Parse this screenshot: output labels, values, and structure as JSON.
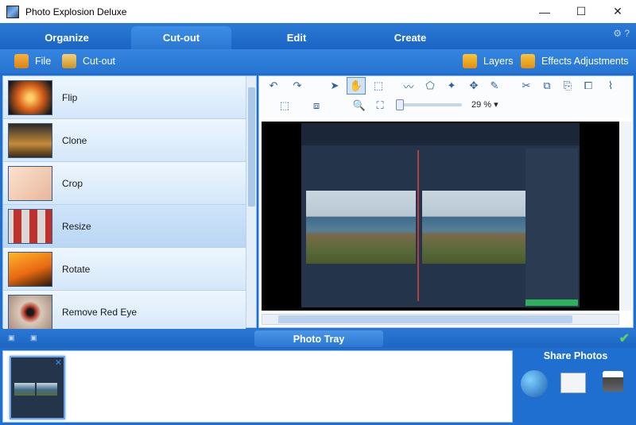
{
  "window": {
    "title": "Photo Explosion Deluxe",
    "minimize": "—",
    "maximize": "☐",
    "close": "✕"
  },
  "tabs": [
    {
      "label": "Organize"
    },
    {
      "label": "Cut-out"
    },
    {
      "label": "Edit"
    },
    {
      "label": "Create"
    }
  ],
  "help": {
    "settings": "⚙",
    "question": "?"
  },
  "subtoolbar": {
    "file": "File",
    "cutout": "Cut-out",
    "layers": "Layers",
    "effects": "Effects Adjustments"
  },
  "tools": [
    {
      "label": "Flip"
    },
    {
      "label": "Clone"
    },
    {
      "label": "Crop"
    },
    {
      "label": "Resize"
    },
    {
      "label": "Rotate"
    },
    {
      "label": "Remove Red Eye"
    }
  ],
  "editor": {
    "zoom": "29 %",
    "zoom_level": 0.29
  },
  "tray": {
    "title": "Photo Tray"
  },
  "share": {
    "title": "Share Photos"
  },
  "colors": {
    "accent": "#1f6fd0",
    "panel": "#d6e8f8",
    "check": "#5fd05f"
  }
}
